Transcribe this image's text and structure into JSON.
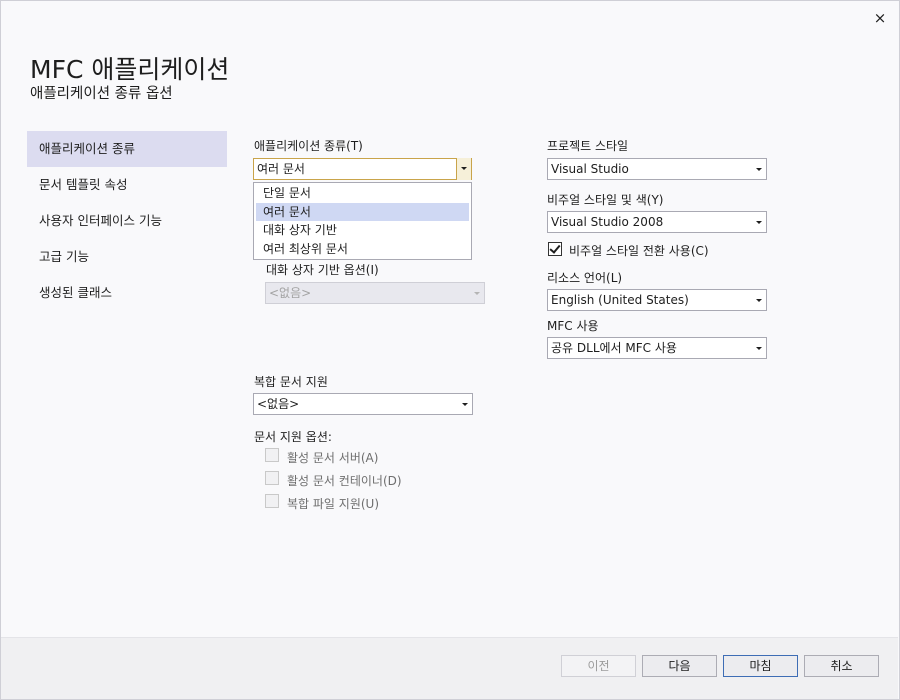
{
  "window": {
    "title": "MFC 애플리케이션",
    "subtitle": "애플리케이션 종류 옵션",
    "close_icon": "×"
  },
  "nav": {
    "items": [
      {
        "label": "애플리케이션 종류",
        "active": true
      },
      {
        "label": "문서 템플릿 속성"
      },
      {
        "label": "사용자 인터페이스 기능"
      },
      {
        "label": "고급 기능"
      },
      {
        "label": "생성된 클래스"
      }
    ]
  },
  "app_type": {
    "label": "애플리케이션 종류(T)",
    "value": "여러 문서",
    "options": [
      "단일 문서",
      "여러 문서",
      "대화 상자 기반",
      "여러 최상위 문서"
    ],
    "selected_index": 1
  },
  "dialog_options": {
    "label": "대화 상자 기반 옵션(I)",
    "value": "<없음>"
  },
  "compound": {
    "label": "복합 문서 지원",
    "value": "<없음>"
  },
  "doc_support": {
    "label": "문서 지원 옵션:",
    "items": [
      {
        "label": "활성 문서 서버(A)",
        "checked": false
      },
      {
        "label": "활성 문서 컨테이너(D)",
        "checked": false
      },
      {
        "label": "복합 파일 지원(U)",
        "checked": false
      }
    ]
  },
  "project_style": {
    "label": "프로젝트 스타일",
    "value": "Visual Studio"
  },
  "visual_style": {
    "label": "비주얼 스타일 및 색(Y)",
    "value": "Visual Studio 2008"
  },
  "style_switch": {
    "label": "비주얼 스타일 전환 사용(C)",
    "checked": true
  },
  "resource_lang": {
    "label": "리소스 언어(L)",
    "value": "English (United States)"
  },
  "mfc_use": {
    "label": "MFC 사용",
    "value": "공유 DLL에서 MFC 사용"
  },
  "buttons": {
    "prev": "이전",
    "next": "다음",
    "finish": "마침",
    "cancel": "취소"
  },
  "colors": {
    "nav_active": "#dcdcf0",
    "focus_border": "#c9a44a",
    "selected_option": "#cfd8f3",
    "default_button_border": "#3e6db5"
  }
}
